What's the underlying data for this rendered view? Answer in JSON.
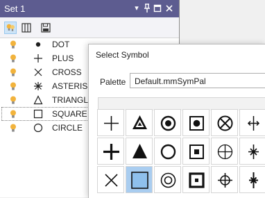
{
  "panel": {
    "title": "Set 1",
    "rows": [
      {
        "label": "DOT",
        "symbol": "dot"
      },
      {
        "label": "PLUS",
        "symbol": "plus"
      },
      {
        "label": "CROSS",
        "symbol": "cross"
      },
      {
        "label": "ASTERISK",
        "symbol": "asterisk"
      },
      {
        "label": "TRIANGLE",
        "symbol": "triangle"
      },
      {
        "label": "SQUARE",
        "symbol": "square"
      },
      {
        "label": "CIRCLE",
        "symbol": "circle"
      }
    ],
    "selected_row": "SQUARE"
  },
  "dialog": {
    "title": "Select Symbol",
    "palette_label": "Palette",
    "palette_value": "Default.mmSymPal",
    "symbols": [
      [
        "plus",
        "triangle-in-triangle",
        "dot-in-circle",
        "dot-in-square",
        "x-in-circle",
        "tailed-plus"
      ],
      [
        "bold-plus",
        "filled-triangle",
        "thick-circle",
        "square-in-square",
        "plus-in-circle",
        "asterisk-bold"
      ],
      [
        "cross",
        "filled-square",
        "circle-in-circle",
        "thick-square",
        "plus-through-circle",
        "asterisk-heavy"
      ]
    ],
    "selected_symbol": "filled-square"
  },
  "colors": {
    "title_bar": "#5d5c90",
    "selection": "#a9cdf0",
    "bulb": "#f2b33c"
  }
}
